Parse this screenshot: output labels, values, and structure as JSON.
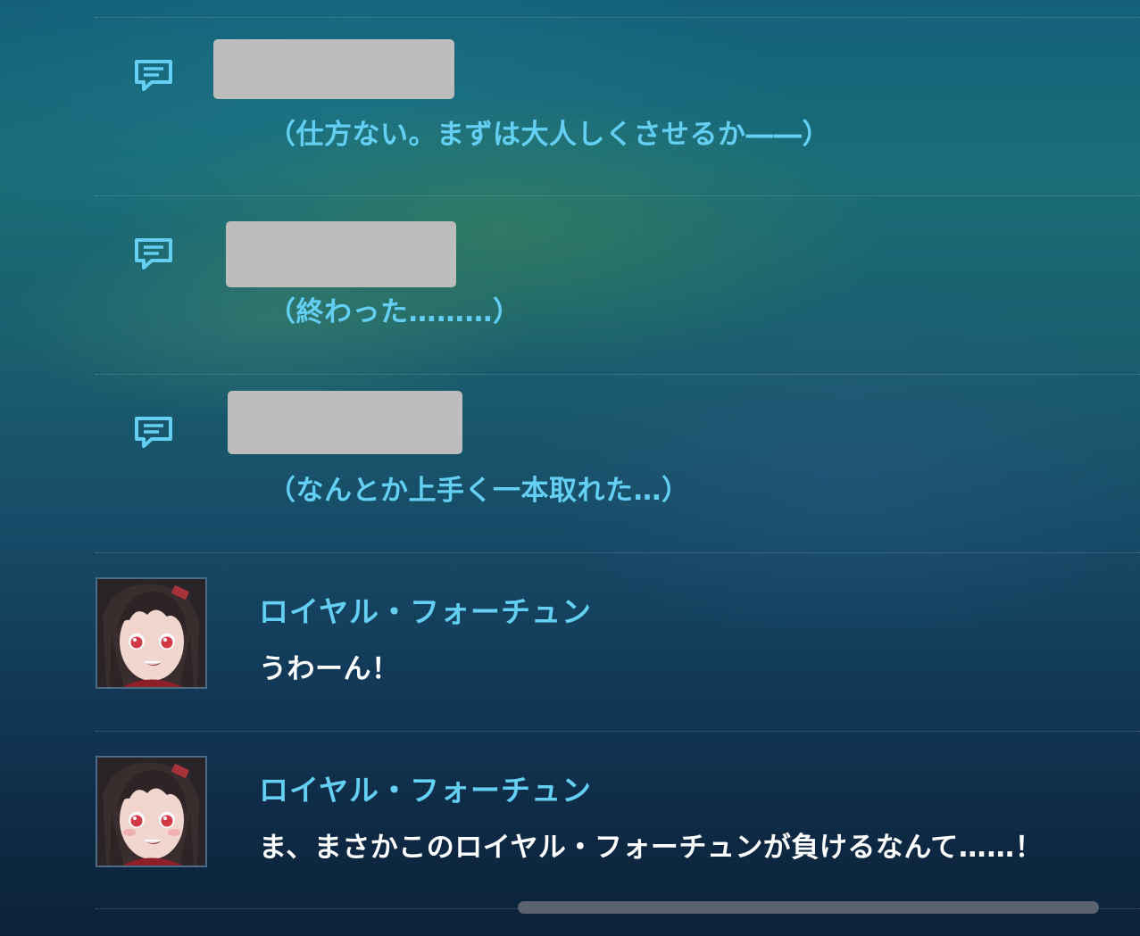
{
  "log": {
    "thoughts": [
      {
        "speaker_redacted": true,
        "icon": "speech-bubble-icon",
        "text": "（仕方ない。まずは大人しくさせるか――）"
      },
      {
        "speaker_redacted": true,
        "icon": "speech-bubble-icon",
        "text": "（終わった………）"
      },
      {
        "speaker_redacted": true,
        "icon": "speech-bubble-icon",
        "text": "（なんとか上手く一本取れた…）"
      }
    ],
    "dialogues": [
      {
        "speaker": "ロイヤル・フォーチュン",
        "text": "うわーん！",
        "avatar": "royal-fortune-portrait"
      },
      {
        "speaker": "ロイヤル・フォーチュン",
        "text": "ま、まさかこのロイヤル・フォーチュンが負けるなんて……！",
        "avatar": "royal-fortune-portrait"
      }
    ]
  },
  "colors": {
    "accent": "#64cff2",
    "dialogue_text": "#ffffff",
    "redaction": "#bdbdbd",
    "scrollbar": "#5b6270"
  }
}
